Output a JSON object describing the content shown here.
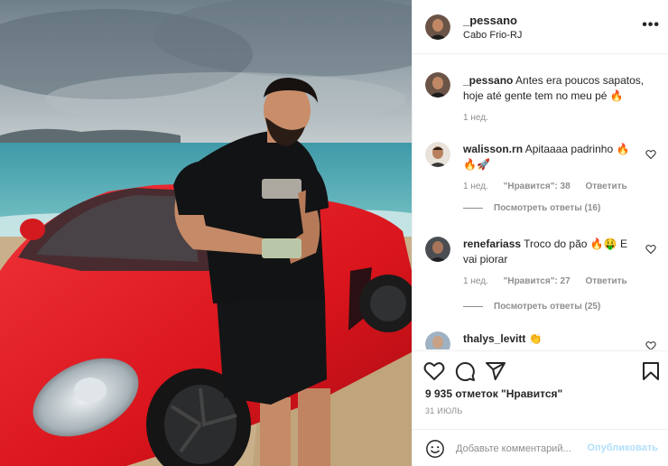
{
  "post": {
    "author": {
      "username": "_pessano",
      "location": "Cabo Frio-RJ"
    },
    "photo": {
      "alt": "Man in black t-shirt leaning on a red convertible sports car at the beach"
    },
    "caption": {
      "username": "_pessano",
      "text": "Antes era poucos sapatos, hoje até gente tem no meu pé 🔥",
      "time": "1 нед."
    },
    "comments": [
      {
        "username": "walisson.rn",
        "text": "Apitaaaa padrinho 🔥🔥🚀",
        "time": "1 нед.",
        "likes": "\"Нравится\": 38",
        "reply": "Ответить",
        "replies": "Посмотреть ответы (16)"
      },
      {
        "username": "renefariass",
        "text": "Troco do pão 🔥🤑 E vai piorar",
        "time": "1 нед.",
        "likes": "\"Нравится\": 27",
        "reply": "Ответить",
        "replies": "Посмотреть ответы (25)"
      },
      {
        "username": "thalys_levitt",
        "text": "👏",
        "time": "",
        "likes": "",
        "reply": "",
        "replies": ""
      }
    ],
    "likes_count": "9 935 отметок \"Нравится\"",
    "date": "31 ИЮЛЬ",
    "add_comment": {
      "placeholder": "Добавьте комментарий...",
      "publish_label": "Опубликовать"
    }
  },
  "icons": {
    "more": "more-options-icon",
    "like": "heart-icon",
    "comment": "comment-bubble-icon",
    "share": "paper-plane-icon",
    "save": "bookmark-icon",
    "emoji": "smiley-icon"
  },
  "colors": {
    "text": "#262626",
    "secondary": "#8e8e8e",
    "divider": "#efefef",
    "publish_disabled": "#b2dffc",
    "car_red": "#e0161c"
  }
}
